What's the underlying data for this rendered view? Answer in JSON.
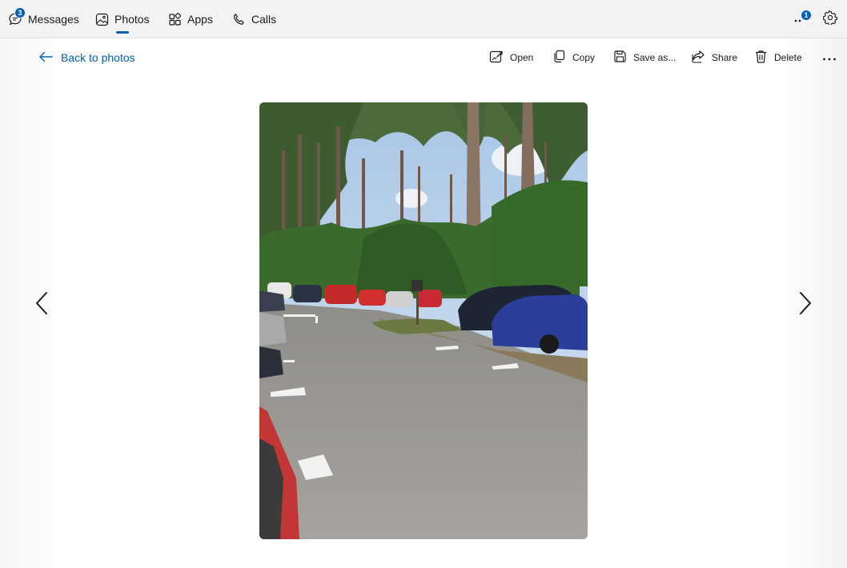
{
  "nav": {
    "tabs": [
      {
        "label": "Messages",
        "icon": "message-icon",
        "badge": "3"
      },
      {
        "label": "Photos",
        "icon": "photo-icon",
        "selected": true
      },
      {
        "label": "Apps",
        "icon": "apps-icon"
      },
      {
        "label": "Calls",
        "icon": "phone-icon"
      }
    ],
    "overflow_badge": "1",
    "accent_color": "#005fb8"
  },
  "viewer": {
    "back_label": "Back to photos",
    "toolbar": {
      "open": "Open",
      "copy": "Copy",
      "save_as": "Save as...",
      "share": "Share",
      "delete": "Delete"
    },
    "photo_subject": "car park among pine trees"
  }
}
